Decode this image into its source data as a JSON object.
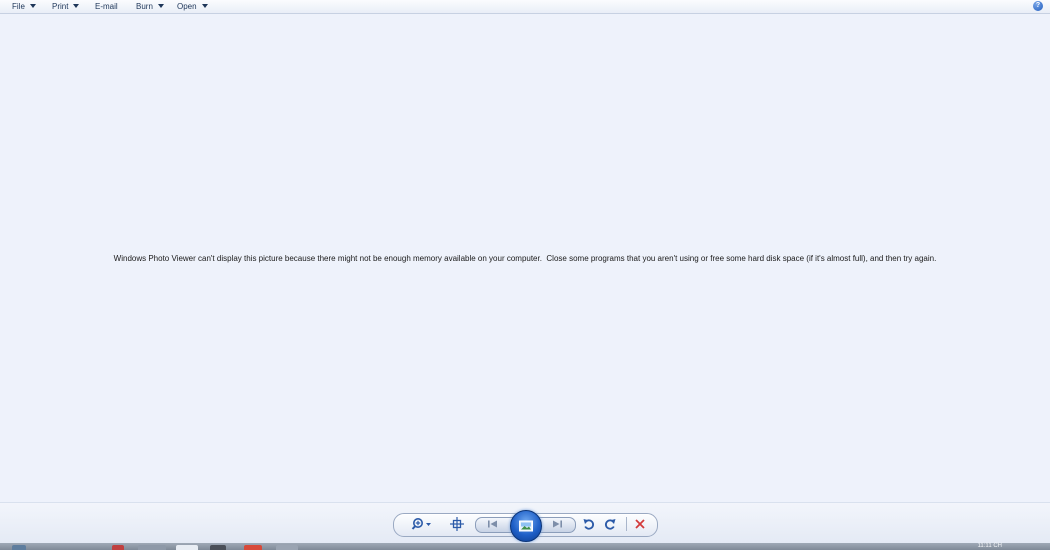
{
  "menubar": {
    "items": [
      {
        "label": "File"
      },
      {
        "label": "Print"
      },
      {
        "label": "E-mail"
      },
      {
        "label": "Burn"
      },
      {
        "label": "Open"
      }
    ],
    "help_icon": "help-icon",
    "help_label": "?"
  },
  "main": {
    "message": "Windows Photo Viewer can't display this picture because there might not be enough memory available on your computer.  Close some programs that you aren't using or free some hard disk space (if it's almost full), and then try again."
  },
  "toolbar": {
    "buttons": [
      {
        "name": "zoom",
        "icon": "magnifier-icon"
      },
      {
        "name": "actual-size",
        "icon": "crosshair-icon"
      },
      {
        "name": "previous",
        "icon": "skip-previous-icon"
      },
      {
        "name": "slideshow",
        "icon": "picture-icon"
      },
      {
        "name": "next",
        "icon": "skip-next-icon"
      },
      {
        "name": "rotate-counterclockwise",
        "icon": "rotate-left-icon"
      },
      {
        "name": "rotate-clockwise",
        "icon": "rotate-right-icon"
      },
      {
        "name": "delete",
        "icon": "close-x-icon"
      }
    ],
    "colors": {
      "accent": "#1e5fc7",
      "delete": "#d33b3b",
      "icon": "#2b5aa8"
    }
  },
  "taskbar": {
    "clock": "11:11 CH"
  }
}
